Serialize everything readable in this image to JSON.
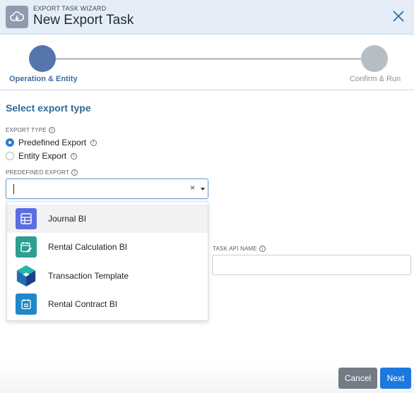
{
  "header": {
    "subtitle": "EXPORT TASK WIZARD",
    "title": "New Export Task",
    "icon": "cloud-download-icon",
    "close_icon": "close-icon"
  },
  "steps": [
    {
      "label": "Operation & Entity",
      "active": true
    },
    {
      "label": "Confirm & Run",
      "active": false
    }
  ],
  "section": {
    "title": "Select export type"
  },
  "export_type": {
    "label": "EXPORT TYPE",
    "info_glyph": "i",
    "options": [
      {
        "label": "Predefined Export",
        "checked": true
      },
      {
        "label": "Entity Export",
        "checked": false
      }
    ]
  },
  "predefined_export": {
    "label": "PREDEFINED EXPORT",
    "info_glyph": "i",
    "value": "",
    "clear_glyph": "×",
    "options": [
      {
        "label": "Journal BI",
        "icon": "table-icon",
        "color": "#5b6ee1"
      },
      {
        "label": "Rental Calculation BI",
        "icon": "calendar-edit-icon",
        "color": "#2f9e8e"
      },
      {
        "label": "Transaction Template",
        "icon": "cube-icon",
        "color": "#1a8fb0"
      },
      {
        "label": "Rental Contract BI",
        "icon": "calendar-icon",
        "color": "#1e88c9"
      }
    ]
  },
  "task_api": {
    "label": "TASK API NAME",
    "info_glyph": "i",
    "value": ""
  },
  "footer": {
    "cancel_label": "Cancel",
    "next_label": "Next"
  },
  "colors": {
    "header_bg": "#e5eef8",
    "step_active": "#5476ad",
    "step_inactive": "#b6bdc3",
    "primary": "#1d78de",
    "cancel": "#737b85"
  }
}
